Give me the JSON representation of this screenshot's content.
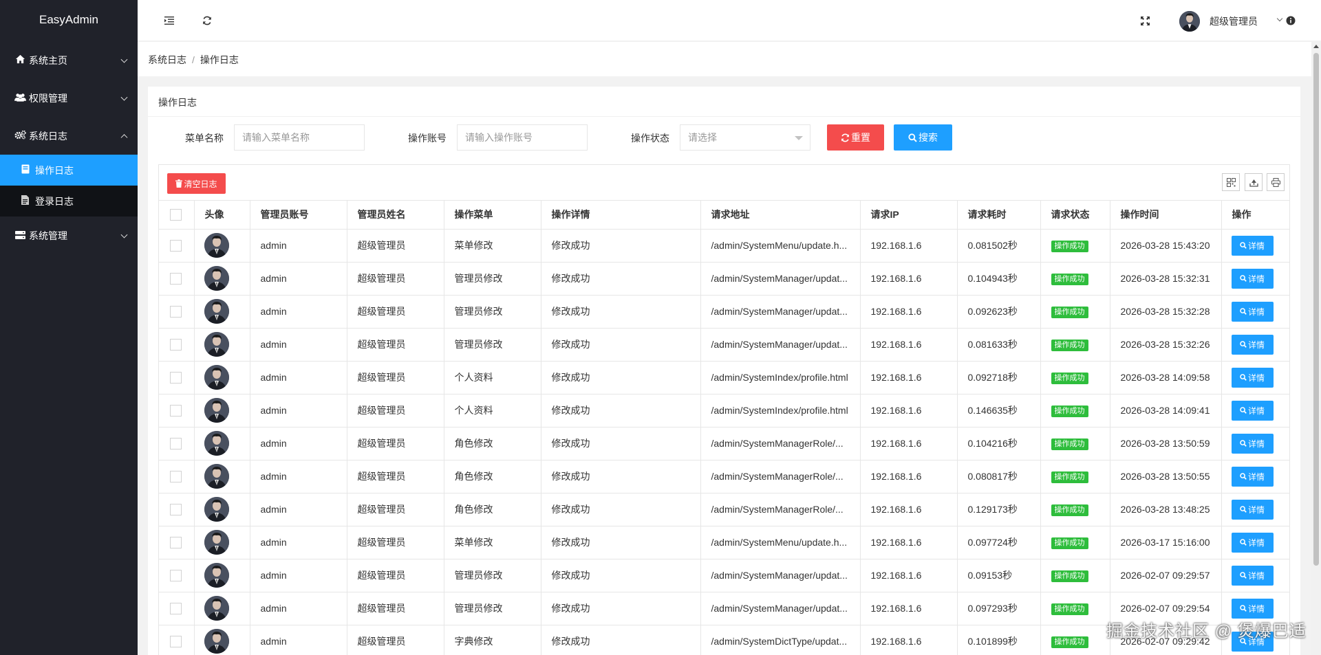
{
  "app": {
    "logo": "EasyAdmin"
  },
  "sidebar": {
    "items": [
      {
        "label": "系统主页",
        "icon": "home-icon",
        "expanded": false
      },
      {
        "label": "权限管理",
        "icon": "users-icon",
        "expanded": false
      },
      {
        "label": "系统日志",
        "icon": "gears-icon",
        "expanded": true,
        "children": [
          {
            "label": "操作日志",
            "icon": "book-icon",
            "active": true
          },
          {
            "label": "登录日志",
            "icon": "file-icon",
            "active": false
          }
        ]
      },
      {
        "label": "系统管理",
        "icon": "server-icon",
        "expanded": false
      }
    ]
  },
  "header": {
    "user_name": "超级管理员"
  },
  "breadcrumb": {
    "parent": "系统日志",
    "separator": "/",
    "current": "操作日志"
  },
  "panel": {
    "title": "操作日志"
  },
  "filters": {
    "menu_label": "菜单名称",
    "menu_placeholder": "请输入菜单名称",
    "account_label": "操作账号",
    "account_placeholder": "请输入操作账号",
    "status_label": "操作状态",
    "status_placeholder": "请选择",
    "reset_label": "重置",
    "search_label": "搜索"
  },
  "toolbar": {
    "clear_label": "清空日志"
  },
  "colors": {
    "sidebar_bg": "#20222a",
    "accent": "#1e9fff",
    "danger": "#f44c4c",
    "success": "#2ebd3c"
  },
  "table": {
    "columns": [
      "头像",
      "管理员账号",
      "管理员姓名",
      "操作菜单",
      "操作详情",
      "请求地址",
      "请求IP",
      "请求耗时",
      "请求状态",
      "操作时间",
      "操作"
    ],
    "detail_label": "详情",
    "rows": [
      {
        "account": "admin",
        "name": "超级管理员",
        "menu": "菜单修改",
        "detail": "修改成功",
        "url": "/admin/SystemMenu/update.h...",
        "ip": "192.168.1.6",
        "cost": "0.081502秒",
        "status": "操作成功",
        "time": "2026-03-28 15:43:20"
      },
      {
        "account": "admin",
        "name": "超级管理员",
        "menu": "管理员修改",
        "detail": "修改成功",
        "url": "/admin/SystemManager/updat...",
        "ip": "192.168.1.6",
        "cost": "0.104943秒",
        "status": "操作成功",
        "time": "2026-03-28 15:32:31"
      },
      {
        "account": "admin",
        "name": "超级管理员",
        "menu": "管理员修改",
        "detail": "修改成功",
        "url": "/admin/SystemManager/updat...",
        "ip": "192.168.1.6",
        "cost": "0.092623秒",
        "status": "操作成功",
        "time": "2026-03-28 15:32:28"
      },
      {
        "account": "admin",
        "name": "超级管理员",
        "menu": "管理员修改",
        "detail": "修改成功",
        "url": "/admin/SystemManager/updat...",
        "ip": "192.168.1.6",
        "cost": "0.081633秒",
        "status": "操作成功",
        "time": "2026-03-28 15:32:26"
      },
      {
        "account": "admin",
        "name": "超级管理员",
        "menu": "个人资料",
        "detail": "修改成功",
        "url": "/admin/SystemIndex/profile.html",
        "ip": "192.168.1.6",
        "cost": "0.092718秒",
        "status": "操作成功",
        "time": "2026-03-28 14:09:58"
      },
      {
        "account": "admin",
        "name": "超级管理员",
        "menu": "个人资料",
        "detail": "修改成功",
        "url": "/admin/SystemIndex/profile.html",
        "ip": "192.168.1.6",
        "cost": "0.146635秒",
        "status": "操作成功",
        "time": "2026-03-28 14:09:41"
      },
      {
        "account": "admin",
        "name": "超级管理员",
        "menu": "角色修改",
        "detail": "修改成功",
        "url": "/admin/SystemManagerRole/...",
        "ip": "192.168.1.6",
        "cost": "0.104216秒",
        "status": "操作成功",
        "time": "2026-03-28 13:50:59"
      },
      {
        "account": "admin",
        "name": "超级管理员",
        "menu": "角色修改",
        "detail": "修改成功",
        "url": "/admin/SystemManagerRole/...",
        "ip": "192.168.1.6",
        "cost": "0.080817秒",
        "status": "操作成功",
        "time": "2026-03-28 13:50:55"
      },
      {
        "account": "admin",
        "name": "超级管理员",
        "menu": "角色修改",
        "detail": "修改成功",
        "url": "/admin/SystemManagerRole/...",
        "ip": "192.168.1.6",
        "cost": "0.129173秒",
        "status": "操作成功",
        "time": "2026-03-28 13:48:25"
      },
      {
        "account": "admin",
        "name": "超级管理员",
        "menu": "菜单修改",
        "detail": "修改成功",
        "url": "/admin/SystemMenu/update.h...",
        "ip": "192.168.1.6",
        "cost": "0.097724秒",
        "status": "操作成功",
        "time": "2026-03-17 15:16:00"
      },
      {
        "account": "admin",
        "name": "超级管理员",
        "menu": "管理员修改",
        "detail": "修改成功",
        "url": "/admin/SystemManager/updat...",
        "ip": "192.168.1.6",
        "cost": "0.09153秒",
        "status": "操作成功",
        "time": "2026-02-07 09:29:57"
      },
      {
        "account": "admin",
        "name": "超级管理员",
        "menu": "管理员修改",
        "detail": "修改成功",
        "url": "/admin/SystemManager/updat...",
        "ip": "192.168.1.6",
        "cost": "0.097293秒",
        "status": "操作成功",
        "time": "2026-02-07 09:29:54"
      },
      {
        "account": "admin",
        "name": "超级管理员",
        "menu": "字典修改",
        "detail": "修改成功",
        "url": "/admin/SystemDictType/updat...",
        "ip": "192.168.1.6",
        "cost": "0.101899秒",
        "status": "操作成功",
        "time": "2026-02-07 09:29:42"
      }
    ]
  },
  "watermark": "掘金技术社区 @ 煲爆巴适"
}
